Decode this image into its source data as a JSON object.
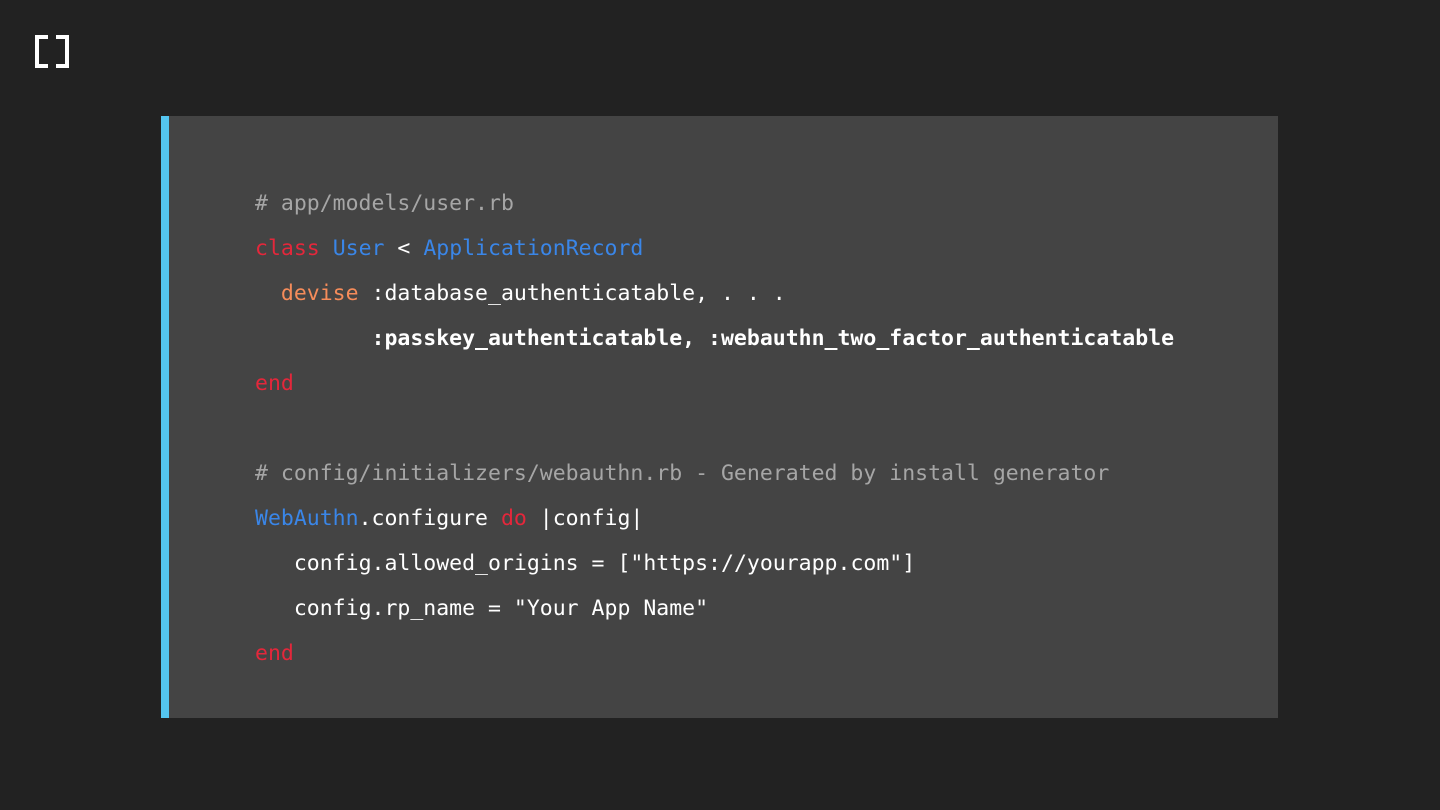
{
  "logo": {
    "icon": "bracket-logo-icon",
    "color": "#ffffff"
  },
  "accent_color": "#54c5ef",
  "code": {
    "l1": {
      "comment": "# app/models/user.rb"
    },
    "l2": {
      "kw": "class",
      "sp1": " ",
      "cls": "User",
      "op": " < ",
      "parent": "ApplicationRecord"
    },
    "l3": {
      "indent": "  ",
      "method": "devise",
      "args": " :database_authenticatable, . . ."
    },
    "l4": {
      "indent": "         ",
      "args": ":passkey_authenticatable, :webauthn_two_factor_authenticatable"
    },
    "l5": {
      "kw": "end"
    },
    "l7": {
      "comment": "# config/initializers/webauthn.rb - Generated by install generator"
    },
    "l8": {
      "cls": "WebAuthn",
      "call": ".configure ",
      "kw": "do",
      "block": " |config|"
    },
    "l9": {
      "indent": "   ",
      "text": "config.allowed_origins = [\"https://yourapp.com\"]"
    },
    "l10": {
      "indent": "   ",
      "text": "config.rp_name = \"Your App Name\""
    },
    "l11": {
      "kw": "end"
    }
  }
}
